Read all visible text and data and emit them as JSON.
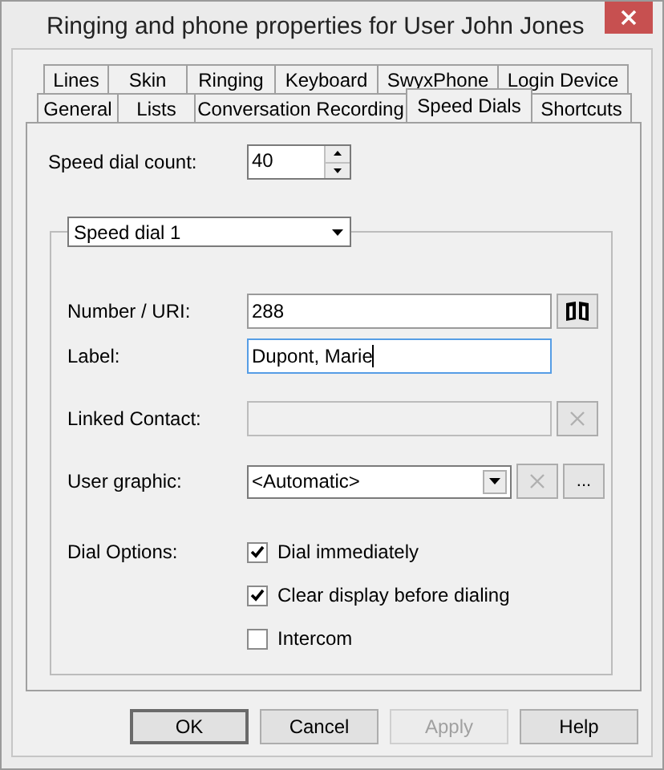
{
  "window": {
    "title": "Ringing and phone properties for User John Jones"
  },
  "tab_rows": [
    [
      {
        "label": "Lines",
        "selected": false
      },
      {
        "label": "Skin",
        "selected": false
      },
      {
        "label": "Ringing",
        "selected": false
      },
      {
        "label": "Keyboard",
        "selected": false
      },
      {
        "label": "SwyxPhone",
        "selected": false
      },
      {
        "label": "Login Device",
        "selected": false
      }
    ],
    [
      {
        "label": "General",
        "selected": false
      },
      {
        "label": "Lists",
        "selected": false
      },
      {
        "label": "Conversation Recording",
        "selected": false
      },
      {
        "label": "Speed Dials",
        "selected": true
      },
      {
        "label": "Shortcuts",
        "selected": false
      }
    ]
  ],
  "speed_dial_count": {
    "label": "Speed dial count:",
    "value": "40"
  },
  "speed_dial_select": {
    "value": "Speed dial 1"
  },
  "fields": [
    {
      "kind": "text",
      "label": "Number / URI:",
      "value": "288",
      "disabled": false,
      "focused": false,
      "buttons": [
        {
          "kind": "book",
          "disabled": false
        }
      ]
    },
    {
      "kind": "text",
      "label": "Label:",
      "value": "Dupont, Marie",
      "disabled": false,
      "focused": true
    },
    {
      "kind": "text",
      "label": "Linked Contact:",
      "disabled": true,
      "focused": false,
      "buttons": [
        {
          "kind": "clear",
          "disabled": true
        }
      ]
    },
    {
      "kind": "combo",
      "label": "User graphic:",
      "value": "<Automatic>",
      "disabled": false,
      "focused": false,
      "buttons": [
        {
          "kind": "clear",
          "disabled": true
        },
        {
          "kind": "more",
          "label": "...",
          "disabled": false
        }
      ]
    }
  ],
  "dial_options": {
    "label": "Dial Options:",
    "options": [
      {
        "label": "Dial immediately",
        "checked": true
      },
      {
        "label": "Clear display before dialing",
        "checked": true
      },
      {
        "label": "Intercom",
        "checked": false
      }
    ]
  },
  "buttons": [
    {
      "label": "OK",
      "disabled": false,
      "default": true
    },
    {
      "label": "Cancel",
      "disabled": false,
      "default": false
    },
    {
      "label": "Apply",
      "disabled": true,
      "default": false
    },
    {
      "label": "Help",
      "disabled": false,
      "default": false
    }
  ]
}
